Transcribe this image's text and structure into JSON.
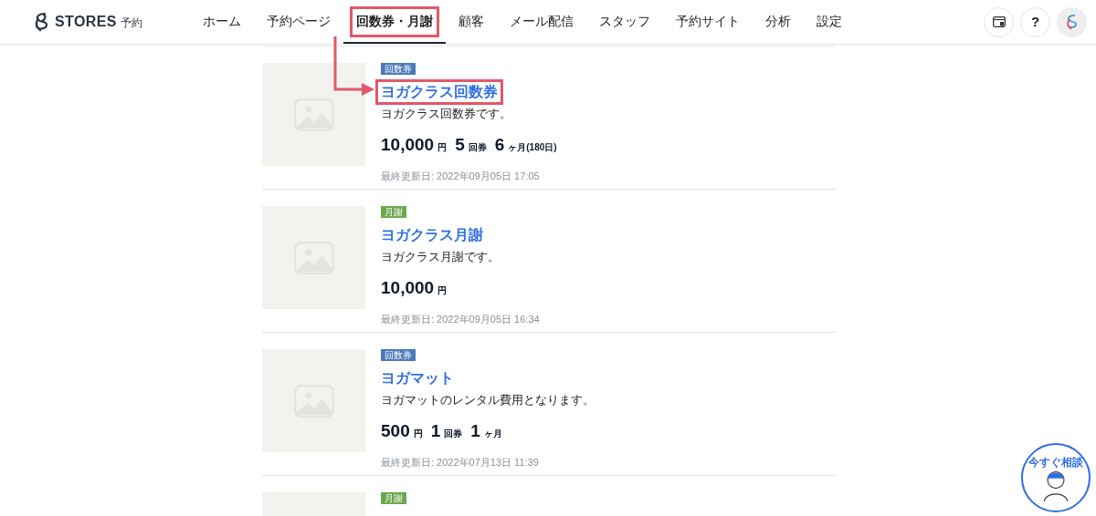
{
  "header": {
    "logo_text": "STORES",
    "logo_suffix": "予約",
    "nav": [
      {
        "label": "ホーム",
        "selected": false,
        "highlighted": false
      },
      {
        "label": "予約ページ",
        "selected": false,
        "highlighted": false
      },
      {
        "label": "回数券・月謝",
        "selected": true,
        "highlighted": true
      },
      {
        "label": "顧客",
        "selected": false,
        "highlighted": false
      },
      {
        "label": "メール配信",
        "selected": false,
        "highlighted": false
      },
      {
        "label": "スタッフ",
        "selected": false,
        "highlighted": false
      },
      {
        "label": "予約サイト",
        "selected": false,
        "highlighted": false
      },
      {
        "label": "分析",
        "selected": false,
        "highlighted": false
      },
      {
        "label": "設定",
        "selected": false,
        "highlighted": false
      }
    ],
    "help_label": "?"
  },
  "items": [
    {
      "tag": {
        "label": "回数券",
        "color": "#4a7ab8"
      },
      "title": "ヨガクラス回数券",
      "highlighted": true,
      "description": "ヨガクラス回数券です。",
      "price": [
        {
          "value": "10,000",
          "unit": "円"
        },
        {
          "value": "5",
          "unit": "回券"
        },
        {
          "value": "6",
          "unit": "ヶ月(180日)"
        }
      ],
      "updated": "最終更新日: 2022年09月05日 17:05"
    },
    {
      "tag": {
        "label": "月謝",
        "color": "#6aa84f"
      },
      "title": "ヨガクラス月謝",
      "highlighted": false,
      "description": "ヨガクラス月謝です。",
      "price": [
        {
          "value": "10,000",
          "unit": "円"
        }
      ],
      "updated": "最終更新日: 2022年09月05日 16:34"
    },
    {
      "tag": {
        "label": "回数券",
        "color": "#4a7ab8"
      },
      "title": "ヨガマット",
      "highlighted": false,
      "description": "ヨガマットのレンタル費用となります。",
      "price": [
        {
          "value": "500",
          "unit": "円"
        },
        {
          "value": "1",
          "unit": "回券"
        },
        {
          "value": "1",
          "unit": "ヶ月"
        }
      ],
      "updated": "最終更新日: 2022年07月13日 11:39"
    },
    {
      "tag": {
        "label": "月謝",
        "color": "#6aa84f"
      }
    }
  ],
  "consult_button": {
    "label": "今すぐ相談"
  }
}
